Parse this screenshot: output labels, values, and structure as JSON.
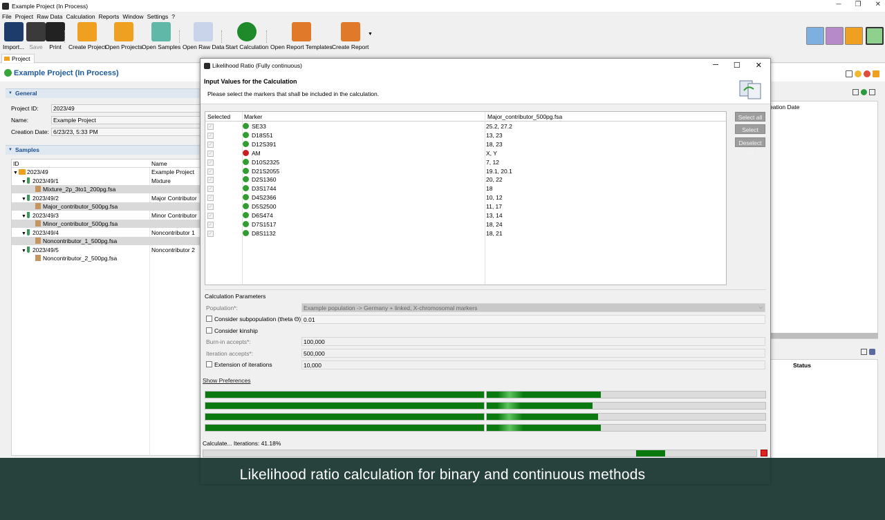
{
  "window": {
    "title": "Example Project (In Process)"
  },
  "menu": [
    "File",
    "Project",
    "Raw Data",
    "Calculation",
    "Reports",
    "Window",
    "Settings",
    "?"
  ],
  "toolbar": {
    "import": "Import...",
    "save": "Save",
    "print": "Print",
    "create_project": "Create Project",
    "open_projects": "Open Projects",
    "open_samples": "Open Samples",
    "open_raw_data": "Open Raw Data",
    "start_calculation": "Start Calculation",
    "open_report_templates": "Open Report Templates",
    "create_report": "Create Report"
  },
  "project": {
    "tab": "Project",
    "title": "Example Project (In Process)",
    "general_label": "General",
    "project_id_label": "Project ID:",
    "project_id": "2023/49",
    "name_label": "Name:",
    "name": "Example Project",
    "creation_date_label": "Creation Date:",
    "creation_date": "6/23/23, 5:33 PM",
    "samples_label": "Samples",
    "tree_headers": {
      "id": "ID",
      "name": "Name"
    },
    "tree": [
      {
        "id": "2023/49",
        "name": "Example Project"
      },
      {
        "id": "2023/49/1",
        "name": "Mixture"
      },
      {
        "id": "Mixture_2p_3to1_200pg.fsa",
        "name": ""
      },
      {
        "id": "2023/49/2",
        "name": "Major Contributor"
      },
      {
        "id": "Major_contributor_500pg.fsa",
        "name": ""
      },
      {
        "id": "2023/49/3",
        "name": "Minor Contributor"
      },
      {
        "id": "Minor_contributor_500pg.fsa",
        "name": ""
      },
      {
        "id": "2023/49/4",
        "name": "Noncontributor 1"
      },
      {
        "id": "Noncontributor_1_500pg.fsa",
        "name": ""
      },
      {
        "id": "2023/49/5",
        "name": "Noncontributor 2"
      },
      {
        "id": "Noncontributor_2_500pg.fsa",
        "name": ""
      }
    ],
    "right_creation_date": "eation Date",
    "right_status": "Status"
  },
  "dialog": {
    "title": "Likelihood Ratio (Fully continuous)",
    "header_title": "Input Values for the Calculation",
    "header_desc": "Please select the markers that shall be included in the calculation.",
    "table_headers": {
      "selected": "Selected",
      "marker": "Marker",
      "value": "Major_contributor_500pg.fsa"
    },
    "markers": [
      {
        "name": "SE33",
        "value": "25.2, 27.2",
        "color": "#2f9d2f"
      },
      {
        "name": "D18S51",
        "value": "13, 23",
        "color": "#2f9d2f"
      },
      {
        "name": "D12S391",
        "value": "18, 23",
        "color": "#2f9d2f"
      },
      {
        "name": "AM",
        "value": "X, Y",
        "color": "#c81e1e"
      },
      {
        "name": "D10S2325",
        "value": "7, 12",
        "color": "#2f9d2f"
      },
      {
        "name": "D21S2055",
        "value": "19.1, 20.1",
        "color": "#2f9d2f"
      },
      {
        "name": "D2S1360",
        "value": "20, 22",
        "color": "#2f9d2f"
      },
      {
        "name": "D3S1744",
        "value": "18",
        "color": "#2f9d2f"
      },
      {
        "name": "D4S2366",
        "value": "10, 12",
        "color": "#2f9d2f"
      },
      {
        "name": "D5S2500",
        "value": "11, 17",
        "color": "#2f9d2f"
      },
      {
        "name": "D6S474",
        "value": "13, 14",
        "color": "#2f9d2f"
      },
      {
        "name": "D7S1517",
        "value": "18, 24",
        "color": "#2f9d2f"
      },
      {
        "name": "D8S1132",
        "value": "18, 21",
        "color": "#2f9d2f"
      }
    ],
    "select_all": "Select all",
    "select_valid": "Select valid",
    "deselect_all": "Deselect all",
    "params_title": "Calculation Parameters",
    "population_label": "Population*:",
    "population": "Example population -> Germany + linked, X-chromosomal markers",
    "subpop_label": "Consider subpopulation (theta Θ)",
    "subpop_value": "0.01",
    "kinship_label": "Consider kinship",
    "burnin_label": "Burn-in accepts*:",
    "burnin_value": "100,000",
    "iter_label": "Iteration accepts*:",
    "iter_value": "500,000",
    "ext_label": "Extension of iterations",
    "ext_value": "10,000",
    "show_prefs": "Show Preferences",
    "progress_bars": [
      {
        "done": 1.0,
        "partial": 0.41
      },
      {
        "done": 1.0,
        "partial": 0.38
      },
      {
        "done": 1.0,
        "partial": 0.4
      },
      {
        "done": 1.0,
        "partial": 0.41
      }
    ],
    "status": "Calculate... Iterations: 41.18%",
    "status_progress": 0.4118
  },
  "caption": "Likelihood ratio calculation for binary and continuous methods"
}
